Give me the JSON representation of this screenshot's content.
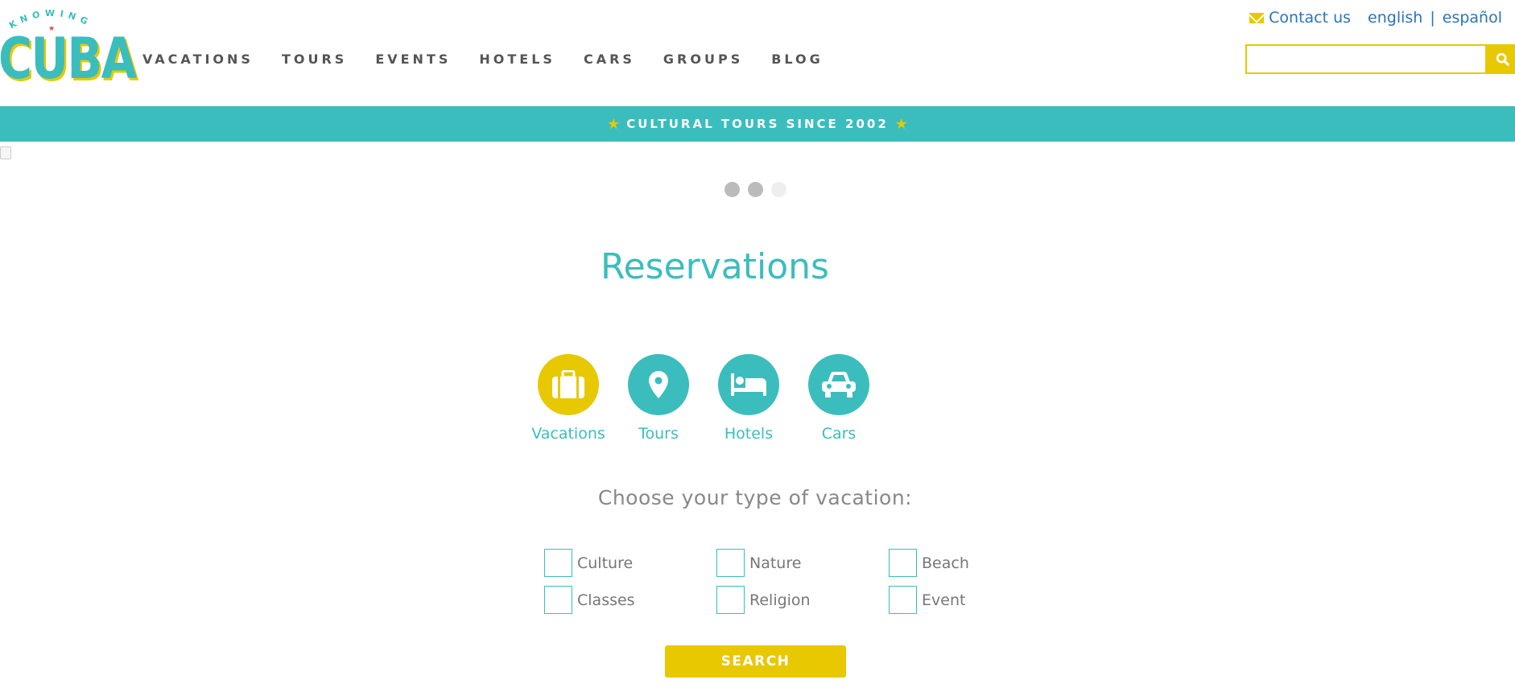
{
  "logo": {
    "top_text": "KNOWING",
    "main_text": "CUBA"
  },
  "nav": {
    "items": [
      "VACATIONS",
      "TOURS",
      "EVENTS",
      "HOTELS",
      "CARS",
      "GROUPS",
      "BLOG"
    ]
  },
  "top_links": {
    "contact": "Contact us",
    "english": "english",
    "separator": "|",
    "spanish": "español"
  },
  "search": {
    "value": "",
    "icon": "search-icon"
  },
  "banner": {
    "text": "CULTURAL TOURS SINCE 2002",
    "star": "★"
  },
  "carousel": {
    "slide_count": 3,
    "active_index": 2
  },
  "reservations": {
    "title": "Reservations",
    "types": [
      {
        "label": "Vacations",
        "icon": "suitcase-icon",
        "active": true
      },
      {
        "label": "Tours",
        "icon": "map-marker-icon",
        "active": false
      },
      {
        "label": "Hotels",
        "icon": "bed-icon",
        "active": false
      },
      {
        "label": "Cars",
        "icon": "car-icon",
        "active": false
      }
    ],
    "choose_label": "Choose your type of vacation:",
    "options": [
      {
        "label": "Culture",
        "checked": false
      },
      {
        "label": "Nature",
        "checked": false
      },
      {
        "label": "Beach",
        "checked": false
      },
      {
        "label": "Classes",
        "checked": false
      },
      {
        "label": "Religion",
        "checked": false
      },
      {
        "label": "Event",
        "checked": false
      }
    ],
    "submit_label": "SEARCH"
  },
  "colors": {
    "teal": "#3bbdbd",
    "yellow": "#e8c800",
    "link_blue": "#2a74b8"
  }
}
